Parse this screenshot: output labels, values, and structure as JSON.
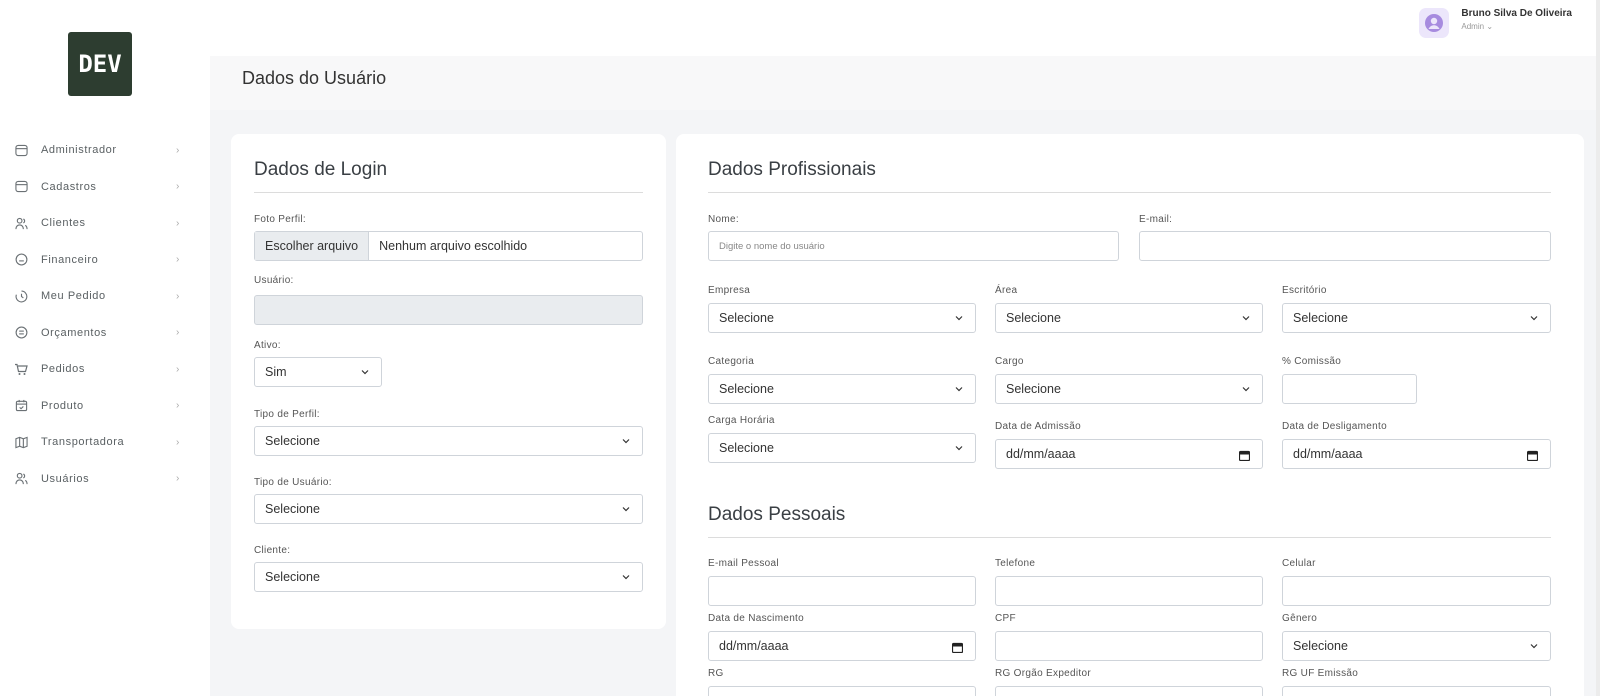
{
  "app": {
    "logo_text": "DEV"
  },
  "sidebar": {
    "items": [
      {
        "label": "Administrador",
        "icon": "window-icon"
      },
      {
        "label": "Cadastros",
        "icon": "window-icon"
      },
      {
        "label": "Clientes",
        "icon": "users-icon"
      },
      {
        "label": "Financeiro",
        "icon": "coin-icon"
      },
      {
        "label": "Meu Pedido",
        "icon": "clock-icon"
      },
      {
        "label": "Orçamentos",
        "icon": "budget-icon"
      },
      {
        "label": "Pedidos",
        "icon": "cart-icon"
      },
      {
        "label": "Produto",
        "icon": "calendar-check-icon"
      },
      {
        "label": "Transportadora",
        "icon": "map-icon"
      },
      {
        "label": "Usuários",
        "icon": "users-icon"
      }
    ]
  },
  "header": {
    "user_name": "Bruno Silva De Oliveira",
    "user_role": "Admin"
  },
  "page": {
    "title": "Dados do Usuário"
  },
  "login": {
    "title": "Dados de Login",
    "foto_label": "Foto Perfil:",
    "file_button": "Escolher arquivo",
    "file_name": "Nenhum arquivo escolhido",
    "usuario_label": "Usuário:",
    "ativo_label": "Ativo:",
    "ativo_value": "Sim",
    "tipo_perfil_label": "Tipo de Perfil:",
    "tipo_perfil_value": "Selecione",
    "tipo_usuario_label": "Tipo de Usuário:",
    "tipo_usuario_value": "Selecione",
    "cliente_label": "Cliente:",
    "cliente_value": "Selecione"
  },
  "profissional": {
    "title": "Dados Profissionais",
    "nome_label": "Nome:",
    "nome_placeholder": "Digite o nome do usuário",
    "email_label": "E-mail:",
    "empresa_label": "Empresa",
    "empresa_value": "Selecione",
    "area_label": "Área",
    "area_value": "Selecione",
    "escritorio_label": "Escritório",
    "escritorio_value": "Selecione",
    "categoria_label": "Categoria",
    "categoria_value": "Selecione",
    "cargo_label": "Cargo",
    "cargo_value": "Selecione",
    "comissao_label": "% Comissão",
    "carga_label": "Carga Horária",
    "carga_value": "Selecione",
    "admissao_label": "Data de Admissão",
    "admissao_value": "dd/mm/aaaa",
    "desligamento_label": "Data de Desligamento",
    "desligamento_value": "dd/mm/aaaa"
  },
  "pessoal": {
    "title": "Dados Pessoais",
    "email_label": "E-mail Pessoal",
    "telefone_label": "Telefone",
    "celular_label": "Celular",
    "nascimento_label": "Data de Nascimento",
    "nascimento_value": "dd/mm/aaaa",
    "cpf_label": "CPF",
    "genero_label": "Gênero",
    "genero_value": "Selecione",
    "rg_label": "RG",
    "rg_orgao_label": "RG Orgão Expeditor",
    "rg_uf_label": "RG UF Emissão"
  }
}
